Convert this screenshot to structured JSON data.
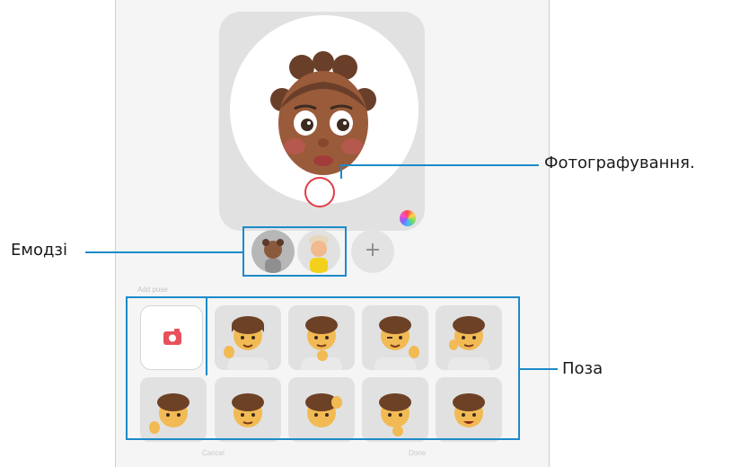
{
  "callouts": {
    "capture": "Фотографування.",
    "emoji": "Емодзі",
    "pose": "Поза"
  },
  "screen": {
    "section_title": "Add pose",
    "add_emoji": "+",
    "cancel_label": "Cancel",
    "done_label": "Done"
  },
  "emoji_list": [
    {
      "icon": "ar-emoji-avatar-girl"
    },
    {
      "icon": "ar-emoji-avatar-boy-hat"
    }
  ],
  "poses_row1": [
    "waving",
    "pointing",
    "wink-peace",
    "hand-on-cheek"
  ],
  "poses_row2": [
    "waving-small",
    "side-turn",
    "hand-on-head",
    "thinking",
    "smiling"
  ],
  "colors": {
    "accent_blue": "#1d8ac9",
    "shutter_red": "#e33b45",
    "camera_red": "#e8505b"
  }
}
